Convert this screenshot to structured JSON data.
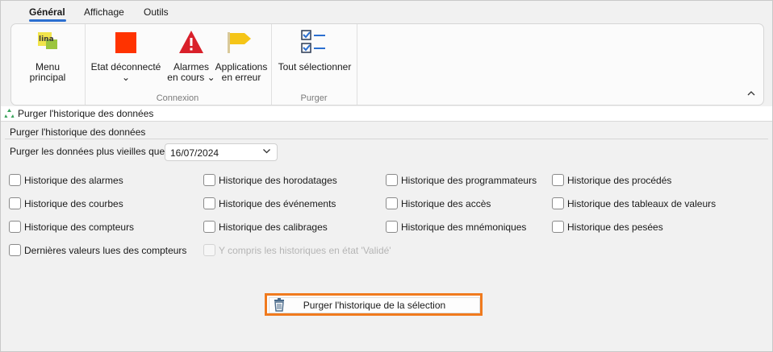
{
  "tabs": [
    {
      "label": "Général",
      "active": true
    },
    {
      "label": "Affichage",
      "active": false
    },
    {
      "label": "Outils",
      "active": false
    }
  ],
  "ribbon": {
    "menu_principal": {
      "label": "Menu principal",
      "icon": "lina-energie-logo-icon",
      "logo_text": "lina"
    },
    "etat": {
      "label": "Etat déconnecté",
      "icon": "red-square-icon"
    },
    "alarmes": {
      "label_line1": "Alarmes",
      "label_line2": "en cours",
      "icon": "warning-triangle-icon"
    },
    "applications": {
      "label_line1": "Applications",
      "label_line2": "en erreur",
      "icon": "yellow-flag-icon"
    },
    "tout": {
      "label": "Tout sélectionner",
      "icon": "checklist-icon"
    },
    "groups": {
      "connexion": "Connexion",
      "purger": "Purger"
    },
    "colors": {
      "red": "#ff3300",
      "warning": "#d9202a",
      "flag": "#f5c518",
      "check_blue": "#2b6fd0"
    }
  },
  "breadcrumb": {
    "label": "Purger l'historique des données",
    "icon": "recycle-icon"
  },
  "form": {
    "group_title": "Purger l'historique des données",
    "date_label": "Purger les données plus vieilles que :",
    "date_value": "16/07/2024",
    "checkboxes": [
      "Historique des alarmes",
      "Historique des horodatages",
      "Historique des programmateurs",
      "Historique des procédés",
      "Historique des courbes",
      "Historique des événements",
      "Historique des accès",
      "Historique des tableaux de valeurs",
      "Historique des compteurs",
      "Historique des calibrages",
      "Historique des mnémoniques",
      "Historique des pesées",
      "Dernières valeurs lues des compteurs"
    ],
    "disabled_checkbox": "Y compris les historiques en état 'Validé'",
    "purge_button": "Purger l'historique de la sélection",
    "highlight_color": "#f07a1e"
  }
}
